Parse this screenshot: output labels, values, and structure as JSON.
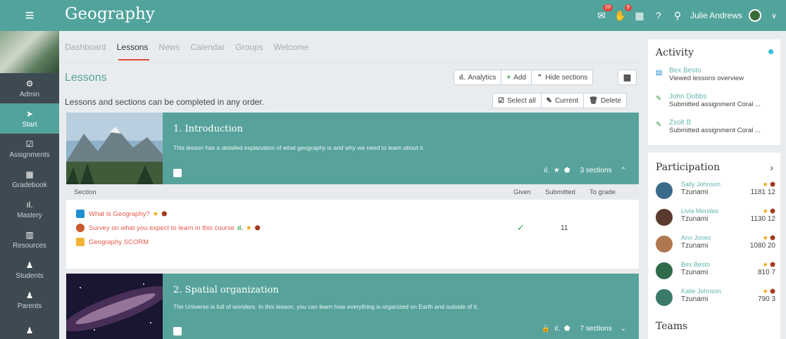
{
  "app": {
    "title": "Geography",
    "menu_icon": "≡"
  },
  "header": {
    "user_name": "Julie Andrews",
    "badges": {
      "notifications": "29",
      "alerts": "9"
    },
    "icons": [
      "notifications-icon",
      "alerts-icon",
      "calendar-icon",
      "help-icon",
      "search-icon",
      "avatar",
      "chevron-down-icon"
    ]
  },
  "sidebar": {
    "items": [
      {
        "label": "Admin",
        "icon": "⚙"
      },
      {
        "label": "Start",
        "icon": "➤"
      },
      {
        "label": "Assignments",
        "icon": "☑"
      },
      {
        "label": "Gradebook",
        "icon": "▦"
      },
      {
        "label": "Mastery",
        "icon": "ıl."
      },
      {
        "label": "Resources",
        "icon": "▥"
      },
      {
        "label": "Students",
        "icon": "♟"
      },
      {
        "label": "Parents",
        "icon": "♟"
      },
      {
        "label": "",
        "icon": "♟"
      }
    ],
    "active": "Start"
  },
  "tabs": [
    "Dashboard",
    "Lessons",
    "News",
    "Calendar",
    "Groups",
    "Welcome"
  ],
  "active_tab": "Lessons",
  "lessons_title": "Lessons",
  "lessons_subtitle": "Lessons and sections can be completed in any order.",
  "toolbar": {
    "analytics": "Analytics",
    "add": "Add",
    "hide_sections": "Hide sections",
    "select_all": "Select all",
    "current": "Current",
    "delete": "Delete"
  },
  "lessons": [
    {
      "title": "1. Introduction",
      "description": "This lesson has a detailed explanation of what geography is and why we need to learn about it.",
      "sections_count": "3 sections",
      "table_headers": {
        "section": "Section",
        "given": "Given",
        "submitted": "Submitted",
        "to_grade": "To grade"
      },
      "rows": [
        {
          "label": "What is Geography?",
          "given": "",
          "submitted": ""
        },
        {
          "label": "Survey on what you expect to learn in this course",
          "given": "✓",
          "submitted": "11"
        },
        {
          "label": "Geography SCORM",
          "given": "",
          "submitted": ""
        }
      ]
    },
    {
      "title": "2. Spatial organization",
      "description": "The Universe is full of wonders. In this lesson, you can learn how everything is organized on Earth and outside of it.",
      "sections_count": "7 sections"
    }
  ],
  "activity": {
    "title": "Activity",
    "items": [
      {
        "name": "Bex Besto",
        "text": "Viewed lessons overview"
      },
      {
        "name": "John Dobbs",
        "text": "Submitted assignment Coral ..."
      },
      {
        "name": "Zsolt B",
        "text": "Submitted assignment Coral ..."
      }
    ]
  },
  "participation": {
    "title": "Participation",
    "items": [
      {
        "name": "Sally Johnson",
        "group": "Tzunami",
        "stars": "1181",
        "badges": "12"
      },
      {
        "name": "Livia Mendes",
        "group": "Tzunami",
        "stars": "1130",
        "badges": "12"
      },
      {
        "name": "Ann Jones",
        "group": "Tzunami",
        "stars": "1080",
        "badges": "20"
      },
      {
        "name": "Bex Besto",
        "group": "Tzunami",
        "stars": "810",
        "badges": "7"
      },
      {
        "name": "Katie Johnson",
        "group": "Tzunami",
        "stars": "790",
        "badges": "3"
      }
    ]
  },
  "teams": {
    "title": "Teams"
  }
}
